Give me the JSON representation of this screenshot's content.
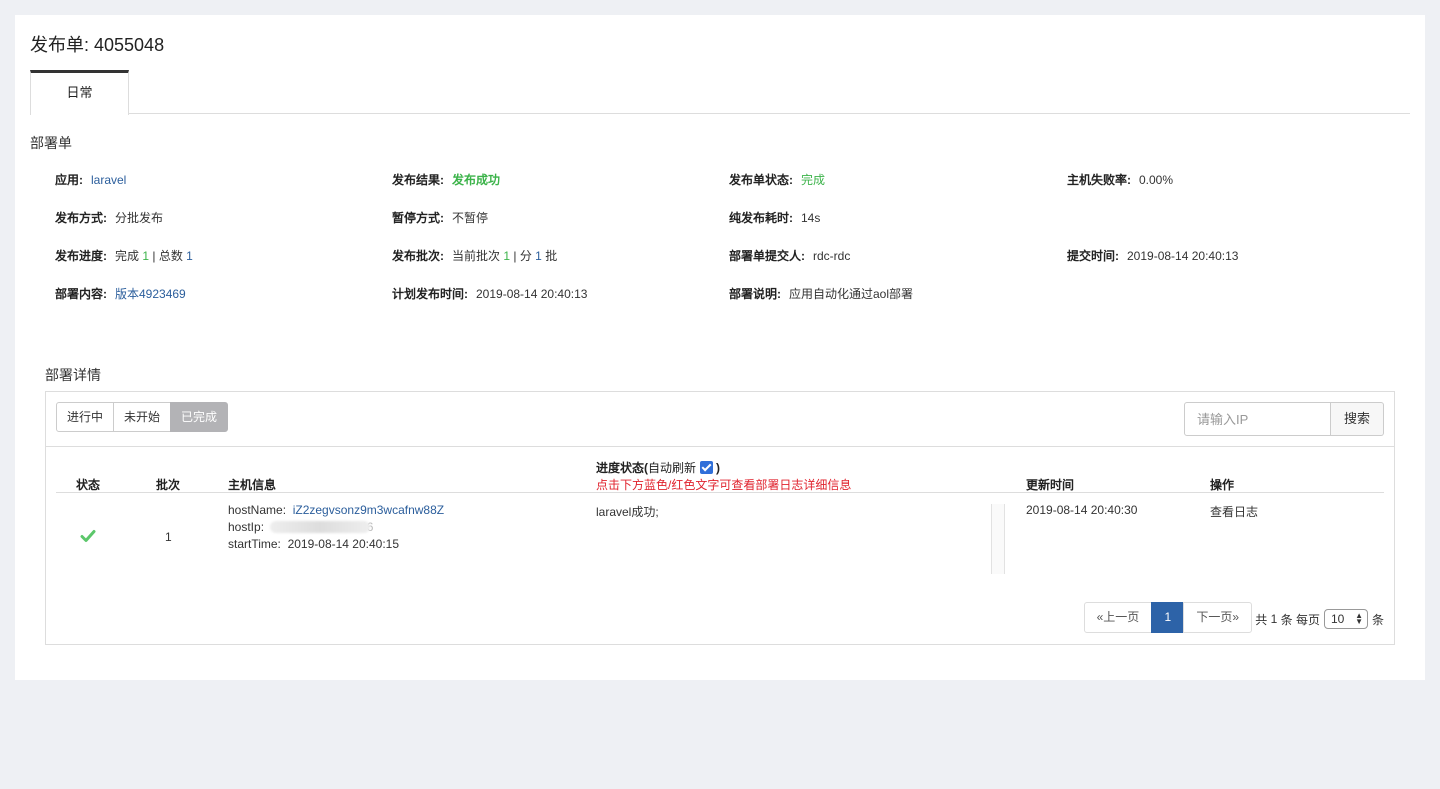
{
  "page": {
    "title": "发布单: 4055048"
  },
  "tabs": [
    {
      "label": "日常"
    }
  ],
  "deploy": {
    "section_title": "部署单",
    "app_label": "应用:",
    "app_value": "laravel",
    "result_label": "发布结果:",
    "result_value": "发布成功",
    "status_label": "发布单状态:",
    "status_value": "完成",
    "fail_rate_label": "主机失败率:",
    "fail_rate_value": "0.00%",
    "mode_label": "发布方式:",
    "mode_value": "分批发布",
    "pause_label": "暂停方式:",
    "pause_value": "不暂停",
    "duration_label": "纯发布耗时:",
    "duration_value": "14s",
    "progress_label": "发布进度:",
    "progress_done_text": "完成",
    "progress_done": "1",
    "progress_sep": " | 总数 ",
    "progress_total": "1",
    "batch_label": "发布批次:",
    "batch_current_text": "当前批次",
    "batch_current": "1",
    "batch_sep": " | 分 ",
    "batch_total": "1",
    "batch_unit": " 批",
    "submitter_label": "部署单提交人:",
    "submitter_value": "rdc-rdc",
    "submit_time_label": "提交时间:",
    "submit_time_value": "2019-08-14 20:40:13",
    "content_label": "部署内容:",
    "content_value": "版本4923469",
    "plan_time_label": "计划发布时间:",
    "plan_time_value": "2019-08-14 20:40:13",
    "desc_label": "部署说明:",
    "desc_value": "应用自动化通过aol部署"
  },
  "detail": {
    "title": "部署详情",
    "filters": [
      "进行中",
      "未开始",
      "已完成"
    ],
    "active_filter": "已完成",
    "search_placeholder": "请输入IP",
    "search_button": "搜索",
    "columns": {
      "status": "状态",
      "batch": "批次",
      "host": "主机信息",
      "progress": "进度状态(",
      "auto_refresh": "自动刷新",
      "progress_close": ")",
      "progress_hint": "点击下方蓝色/红色文字可查看部署日志详细信息",
      "updated": "更新时间",
      "action": "操作"
    },
    "rows": [
      {
        "status": "success",
        "batch": "1",
        "host_name_label": "hostName:",
        "host_name": "iZ2zegvsonz9m3wcafnw88Z",
        "host_ip_label": "hostIp:",
        "host_ip_tail": "46",
        "start_time_label": "startTime:",
        "start_time": "2019-08-14 20:40:15",
        "progress": "laravel成功;",
        "updated": "2019-08-14 20:40:30",
        "action": "查看日志"
      }
    ],
    "pagination": {
      "prev": "«上一页",
      "current": "1",
      "next": "下一页»",
      "total_prefix": "共",
      "total": "1",
      "total_suffix": "条 每页",
      "page_size": "10",
      "page_size_suffix": "条"
    }
  },
  "colors": {
    "link": "#2b5e9c",
    "success": "#3cb34a",
    "primary": "#2d63a8",
    "warning_text": "#e0232e"
  }
}
